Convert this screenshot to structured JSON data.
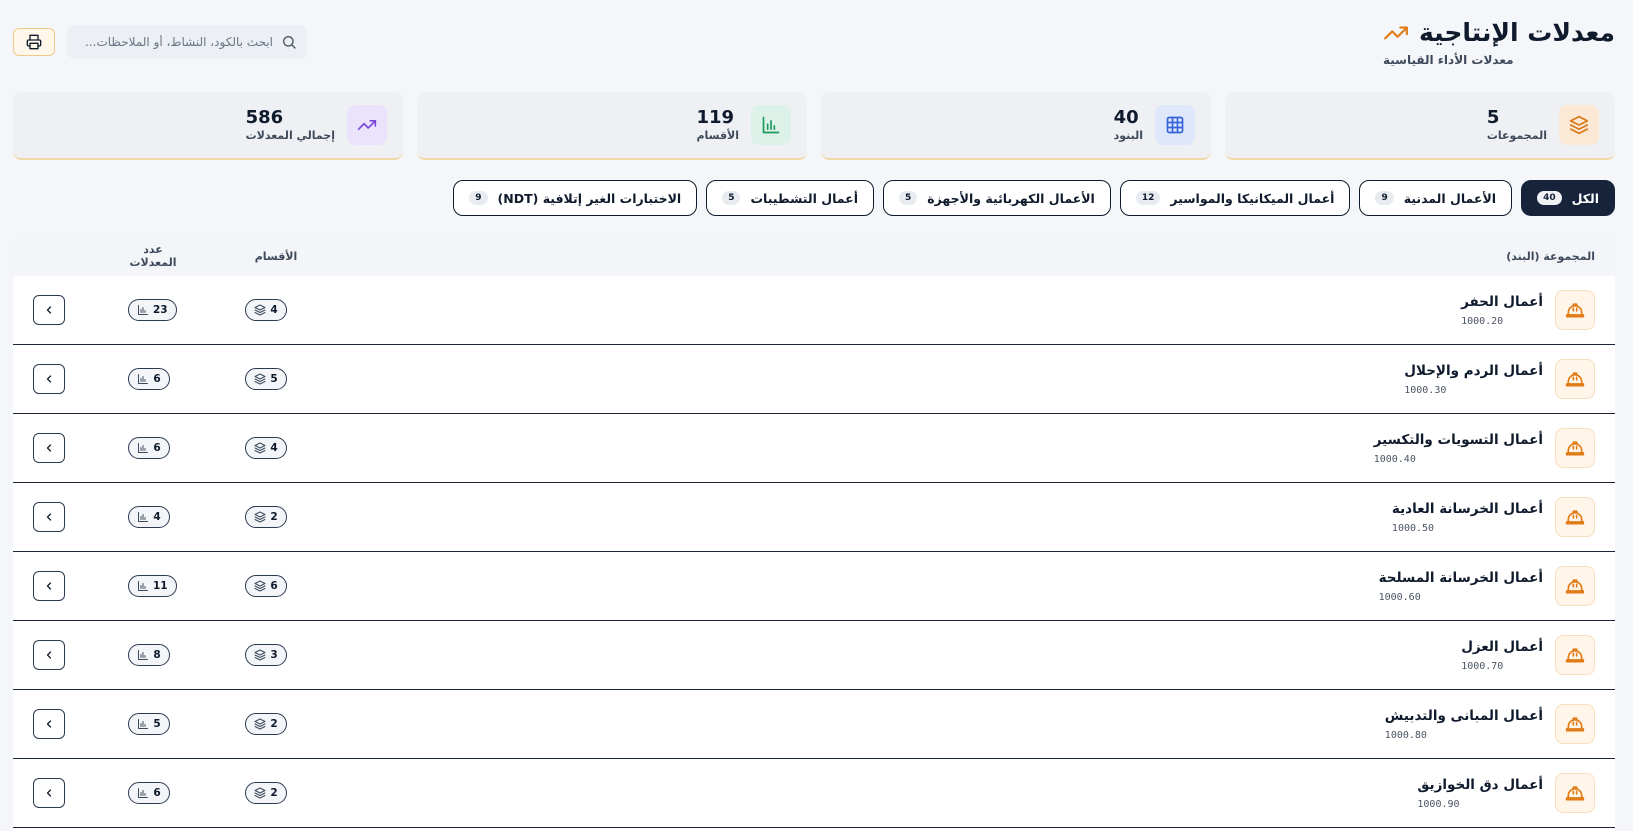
{
  "header": {
    "title": "معدلات الإنتاجية",
    "subtitle": "معدلات الأداء القياسية",
    "search_placeholder": "ابحث بالكود، النشاط، أو الملاحظات...",
    "accent_color": "#e07b16"
  },
  "stats": [
    {
      "value": "5",
      "label": "المجموعات",
      "icon": "layers-icon",
      "bg": "#fbe9d6",
      "fg": "#d9771a"
    },
    {
      "value": "40",
      "label": "البنود",
      "icon": "grid-icon",
      "bg": "#dfe7fb",
      "fg": "#3565d6"
    },
    {
      "value": "119",
      "label": "الأقسام",
      "icon": "bar-chart-icon",
      "bg": "#dcf1e7",
      "fg": "#1f9a5b"
    },
    {
      "value": "586",
      "label": "إجمالي المعدلات",
      "icon": "trending-up-icon",
      "bg": "#ebe2fb",
      "fg": "#7a45d6"
    }
  ],
  "tabs": [
    {
      "label": "الكل",
      "count": "40",
      "active": true
    },
    {
      "label": "الأعمال المدنية",
      "count": "9",
      "active": false
    },
    {
      "label": "أعمال الميكانيكا والمواسير",
      "count": "12",
      "active": false
    },
    {
      "label": "الأعمال الكهربائية والأجهزة",
      "count": "5",
      "active": false
    },
    {
      "label": "أعمال التشطيبات",
      "count": "5",
      "active": false
    },
    {
      "label": "الاختبارات الغير إتلافية (NDT)",
      "count": "9",
      "active": false
    }
  ],
  "table": {
    "headers": {
      "group": "المجموعة (البند)",
      "sections": "الأقسام",
      "rates": "عدد المعدلات"
    },
    "rows": [
      {
        "name": "أعمال الحفر",
        "code": "1000.20",
        "sections": "4",
        "rates": "23"
      },
      {
        "name": "أعمال الردم والإحلال",
        "code": "1000.30",
        "sections": "5",
        "rates": "6"
      },
      {
        "name": "أعمال التسويات والتكسير",
        "code": "1000.40",
        "sections": "4",
        "rates": "6"
      },
      {
        "name": "أعمال الخرسانة العادية",
        "code": "1000.50",
        "sections": "2",
        "rates": "4"
      },
      {
        "name": "أعمال الخرسانة المسلحة",
        "code": "1000.60",
        "sections": "6",
        "rates": "11"
      },
      {
        "name": "أعمال العزل",
        "code": "1000.70",
        "sections": "3",
        "rates": "8"
      },
      {
        "name": "أعمال المبانى والتدبيش",
        "code": "1000.80",
        "sections": "2",
        "rates": "5"
      },
      {
        "name": "أعمال دق الخوازيق",
        "code": "1000.90",
        "sections": "2",
        "rates": "6"
      }
    ]
  }
}
